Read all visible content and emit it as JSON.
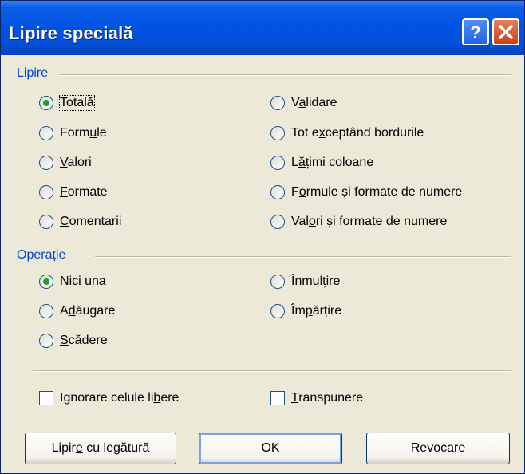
{
  "dialog": {
    "title": "Lipire specială",
    "help_symbol": "?",
    "close_symbol": "✕"
  },
  "paste_group": {
    "label": "Lipire",
    "options_left": [
      {
        "pre": "",
        "acc": "",
        "post": "Totală",
        "selected": true
      },
      {
        "pre": "Form",
        "acc": "u",
        "post": "le",
        "selected": false
      },
      {
        "pre": "",
        "acc": "V",
        "post": "alori",
        "selected": false
      },
      {
        "pre": "",
        "acc": "F",
        "post": "ormate",
        "selected": false
      },
      {
        "pre": "",
        "acc": "C",
        "post": "omentarii",
        "selected": false
      }
    ],
    "options_right": [
      {
        "pre": "V",
        "acc": "a",
        "post": "lidare",
        "selected": false
      },
      {
        "pre": "Tot e",
        "acc": "x",
        "post": "ceptând bordurile",
        "selected": false
      },
      {
        "pre": "L",
        "acc": "ă",
        "post": "țimi coloane",
        "selected": false
      },
      {
        "pre": "F",
        "acc": "o",
        "post": "rmule și formate de numere",
        "selected": false
      },
      {
        "pre": "Val",
        "acc": "o",
        "post": "ri și formate de numere",
        "selected": false
      }
    ]
  },
  "operation_group": {
    "label": "Operație",
    "options_left": [
      {
        "pre": "",
        "acc": "N",
        "post": "ici una",
        "selected": true
      },
      {
        "pre": "A",
        "acc": "d",
        "post": "ăugare",
        "selected": false
      },
      {
        "pre": "",
        "acc": "S",
        "post": "cădere",
        "selected": false
      }
    ],
    "options_right": [
      {
        "pre": "Înm",
        "acc": "u",
        "post": "lțire",
        "selected": false
      },
      {
        "pre": "Îm",
        "acc": "p",
        "post": "ărțire",
        "selected": false
      }
    ]
  },
  "checkboxes": {
    "skip_blanks": {
      "pre": "Ignorare celule li",
      "acc": "b",
      "post": "ere",
      "checked": false
    },
    "transpose": {
      "pre": "",
      "acc": "T",
      "post": "ranspunere",
      "checked": false
    }
  },
  "buttons": {
    "paste_link": {
      "pre": "Lipir",
      "acc": "e",
      "post": " cu legătură"
    },
    "ok": "OK",
    "cancel": "Revocare"
  },
  "colors": {
    "group_label": "#0046d5",
    "title_bar": "#0054e3",
    "radio_dot": "#21a121",
    "background": "#ece9d8"
  }
}
